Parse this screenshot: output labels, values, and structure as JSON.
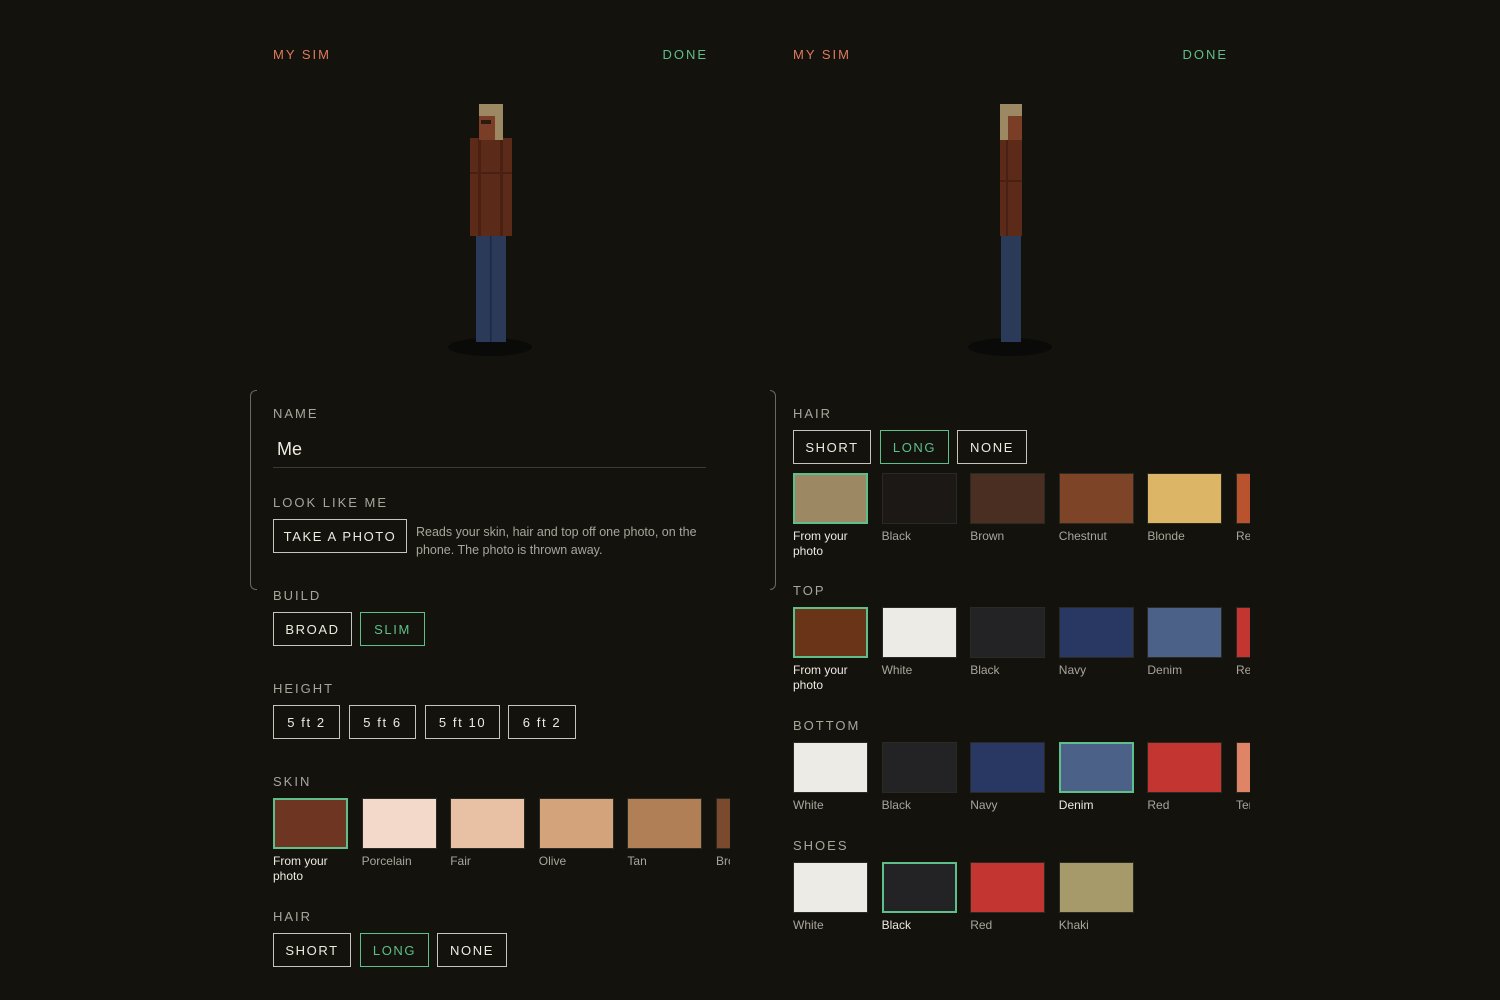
{
  "left": {
    "title": "MY SIM",
    "done": "DONE",
    "name_label": "NAME",
    "name_value": "Me",
    "look_label": "LOOK LIKE ME",
    "take_photo": "TAKE A PHOTO",
    "look_help": "Reads your skin, hair and top off one photo, on the phone. The photo is thrown away.",
    "build_label": "BUILD",
    "build_options": [
      "BROAD",
      "SLIM"
    ],
    "height_label": "HEIGHT",
    "height_options": [
      "5 ft 2",
      "5 ft 6",
      "5 ft 10",
      "6 ft 2"
    ],
    "skin_label": "SKIN",
    "skin": [
      {
        "label": "From your photo",
        "color": "#6e3522"
      },
      {
        "label": "Porcelain",
        "color": "#f2d9c9"
      },
      {
        "label": "Fair",
        "color": "#e8c0a3"
      },
      {
        "label": "Olive",
        "color": "#d3a47c"
      },
      {
        "label": "Tan",
        "color": "#b07f56"
      },
      {
        "label": "Brown",
        "color": "#7a4a2e"
      }
    ],
    "hair_label": "HAIR",
    "hair_options": [
      "SHORT",
      "LONG",
      "NONE"
    ]
  },
  "right": {
    "title": "MY SIM",
    "done": "DONE",
    "hair_label": "HAIR",
    "hair_options": [
      "SHORT",
      "LONG",
      "NONE"
    ],
    "hair_colors": [
      {
        "label": "From your photo",
        "color": "#9c8862"
      },
      {
        "label": "Black",
        "color": "#1c1815"
      },
      {
        "label": "Brown",
        "color": "#4b2e22"
      },
      {
        "label": "Chestnut",
        "color": "#7d4428"
      },
      {
        "label": "Blonde",
        "color": "#dcb566"
      },
      {
        "label": "Red",
        "color": "#b9532d"
      }
    ],
    "top_label": "TOP",
    "top_colors": [
      {
        "label": "From your photo",
        "color": "#6a3419"
      },
      {
        "label": "White",
        "color": "#ecebe6"
      },
      {
        "label": "Black",
        "color": "#232326"
      },
      {
        "label": "Navy",
        "color": "#283862"
      },
      {
        "label": "Denim",
        "color": "#4c6188"
      },
      {
        "label": "Red",
        "color": "#c23530"
      }
    ],
    "bottom_label": "BOTTOM",
    "bottom_colors": [
      {
        "label": "White",
        "color": "#ecebe6"
      },
      {
        "label": "Black",
        "color": "#232326"
      },
      {
        "label": "Navy",
        "color": "#283862"
      },
      {
        "label": "Denim",
        "color": "#4c6188"
      },
      {
        "label": "Red",
        "color": "#c23530"
      },
      {
        "label": "Terracotta",
        "color": "#e08468"
      }
    ],
    "shoes_label": "SHOES",
    "shoe_colors": [
      {
        "label": "White",
        "color": "#ecebe6"
      },
      {
        "label": "Black",
        "color": "#232326"
      },
      {
        "label": "Red",
        "color": "#c23530"
      },
      {
        "label": "Khaki",
        "color": "#a79a6a"
      }
    ]
  }
}
